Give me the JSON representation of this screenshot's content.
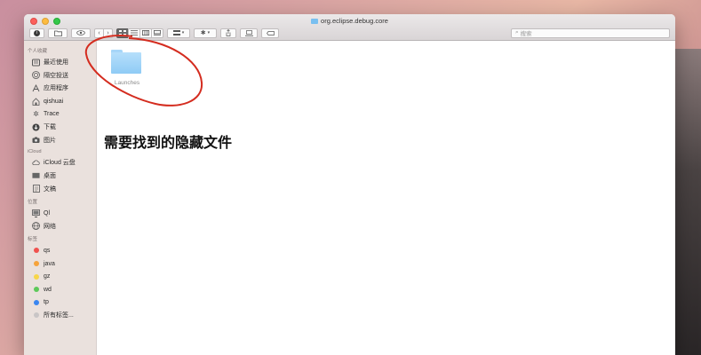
{
  "window": {
    "title": "org.eclipse.debug.core"
  },
  "toolbar": {
    "search_placeholder": "搜索",
    "search_icon": "magnifier-icon"
  },
  "sidebar": {
    "sections": [
      {
        "header": "个人收藏",
        "items": [
          {
            "label": "最近使用",
            "icon": "clock-icon"
          },
          {
            "label": "隔空投送",
            "icon": "airdrop-icon"
          },
          {
            "label": "应用程序",
            "icon": "applications-icon"
          },
          {
            "label": "qishuai",
            "icon": "home-icon"
          },
          {
            "label": "Trace",
            "icon": "gear-icon"
          },
          {
            "label": "下载",
            "icon": "download-icon"
          },
          {
            "label": "图片",
            "icon": "camera-icon"
          }
        ]
      },
      {
        "header": "iCloud",
        "items": [
          {
            "label": "iCloud 云盘",
            "icon": "cloud-icon"
          },
          {
            "label": "桌面",
            "icon": "desktop-icon"
          },
          {
            "label": "文稿",
            "icon": "document-icon"
          }
        ]
      },
      {
        "header": "位置",
        "items": [
          {
            "label": "Ql",
            "icon": "computer-icon"
          },
          {
            "label": "网络",
            "icon": "network-icon"
          }
        ]
      },
      {
        "header": "标签",
        "items": [
          {
            "label": "qs",
            "color": "#f0524f"
          },
          {
            "label": "java",
            "color": "#f6a33b"
          },
          {
            "label": "gz",
            "color": "#f7d64a"
          },
          {
            "label": "wd",
            "color": "#5dc95a"
          },
          {
            "label": "tp",
            "color": "#3a86f0"
          },
          {
            "label": "所有标签...",
            "color": "#c9c5c6"
          }
        ]
      }
    ]
  },
  "content": {
    "folder_name": "Launches",
    "annotation_text": "需要找到的隐藏文件",
    "annotation_color": "#d42c1f"
  }
}
